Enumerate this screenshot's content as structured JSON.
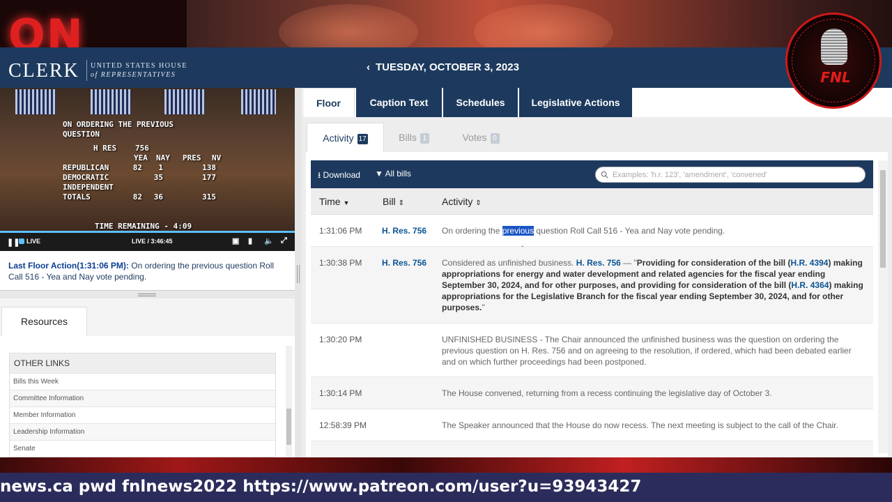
{
  "studio": {
    "on_air": "ON AIR"
  },
  "badge": {
    "text": "FNL"
  },
  "header": {
    "logo_word": "CLERK",
    "logo_line1": "UNITED STATES HOUSE",
    "logo_line2": "of REPRESENTATIVES",
    "date": "TUESDAY, OCTOBER 3, 2023"
  },
  "video": {
    "overlay_title_1": "ON ORDERING THE PREVIOUS",
    "overlay_title_2": "QUESTION",
    "measure_label": "H RES",
    "measure_num": "756",
    "col_headers": [
      "YEA",
      "NAY",
      "PRES",
      "NV"
    ],
    "tally": [
      {
        "party": "REPUBLICAN",
        "yea": "82",
        "nay": "1",
        "pres": "",
        "nv": "138"
      },
      {
        "party": "DEMOCRATIC",
        "yea": "",
        "nay": "35",
        "pres": "",
        "nv": "177"
      },
      {
        "party": "INDEPENDENT",
        "yea": "",
        "nay": "",
        "pres": "",
        "nv": ""
      },
      {
        "party": "TOTALS",
        "yea": "82",
        "nay": "36",
        "pres": "",
        "nv": "315"
      }
    ],
    "time_remaining": "TIME REMAINING - 4:09",
    "live_label": "LIVE",
    "live_time": "LIVE / 3:46:45"
  },
  "last_action": {
    "label": "Last Floor Action(1:31:06 PM):",
    "text": " On ordering the previous question Roll Call 516 - Yea and Nay vote pending."
  },
  "resources": {
    "tab": "Resources",
    "heading": "OTHER LINKS",
    "links": [
      "Bills this Week",
      "Committee Information",
      "Member Information",
      "Leadership Information",
      "Senate"
    ]
  },
  "main_tabs": [
    "Floor",
    "Caption Text",
    "Schedules",
    "Legislative Actions"
  ],
  "sub_tabs": [
    {
      "label": "Activity",
      "count": "17"
    },
    {
      "label": "Bills",
      "count": "1"
    },
    {
      "label": "Votes",
      "count": "0"
    }
  ],
  "toolbar": {
    "download": "Download",
    "filter": "All bills",
    "search_placeholder": "Examples: 'h.r. 123', 'amendment', 'convened'"
  },
  "columns": [
    "Time",
    "Bill",
    "Activity"
  ],
  "rows": [
    {
      "time": "1:31:06 PM",
      "bill": "H. Res. 756",
      "pre": "On ordering the ",
      "hl": "previous",
      "post": " question Roll Call 516 - Yea and Nay vote pending."
    },
    {
      "time": "1:30:38 PM",
      "bill": "H. Res. 756",
      "a1": "Considered as unfinished business. ",
      "a2": "H. Res. 756",
      "a3": " — \"",
      "a4": "Providing for consideration of the bill (",
      "a5": "H.R. 4394",
      "a6": ") making appropriations for energy and water development and related agencies for the fiscal year ending September 30, 2024, and for other purposes, and providing for consideration of the bill (",
      "a7": "H.R. 4364",
      "a8": ") making appropriations for the Legislative Branch for the fiscal year ending September 30, 2024, and for other purposes.",
      "a9": "\""
    },
    {
      "time": "1:30:20 PM",
      "bill": "",
      "text": "UNFINISHED BUSINESS - The Chair announced the unfinished business was the question on ordering the previous question on H. Res. 756 and on agreeing to the resolution, if ordered, which had been debated earlier and on which further proceedings had been postponed."
    },
    {
      "time": "1:30:14 PM",
      "bill": "",
      "text": "The House convened, returning from a recess continuing the legislative day of October 3."
    },
    {
      "time": "12:58:39 PM",
      "bill": "",
      "text": "The Speaker announced that the House do now recess. The next meeting is subject to the call of the Chair."
    }
  ],
  "ticker": {
    "text": "news.ca pwd fnlnews2022 https://www.patreon.com/user?u=93943427"
  }
}
